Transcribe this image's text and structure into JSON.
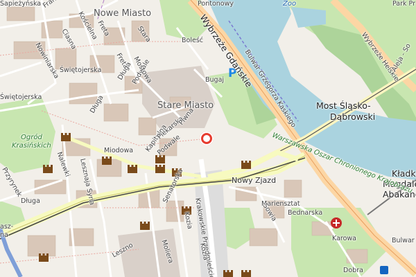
{
  "map": {
    "pin_name": "location-pin",
    "labels": {
      "nowe_miasto": "Nowe Miasto",
      "stare_miasto": "Stare Miasto",
      "most": "Most Śląsko-",
      "most2": "Dąbrowski",
      "kladka1": "Kładka",
      "kladka2": "Magdale",
      "kladka3": "Abakanow",
      "ogrod1": "Ogród",
      "ogrod2": "Krasińskich",
      "nowy_zjazd": "Nowy Zjazd",
      "marienszat": "Mariensztat",
      "wybrzeze_gdanskie": "Wybrzeże Gdańskie",
      "wybrzeze_helskie": "Wybrzeże Helskie",
      "aleja": "Aleja - So",
      "bulwar_kaskiego": "Bulwar Grzegorza Kaskiego",
      "warszawska_trasa": "Warszawska Oszar Chronionego Krajobrazu",
      "park_praski": "Park Pr",
      "zoo": "Zoo",
      "pontonowy": "Pontonowy",
      "bulwar_gier": "Bulwar gen",
      "karowa": "Karowa",
      "dobra": "Dobra",
      "miodowa": "Miodowa",
      "senatorska": "Senatorska",
      "moliera": "Moliera",
      "krakowskie": "Krakowskie Przedmieście",
      "kozia": "Kozia",
      "bednarska": "Bednarska",
      "sowia": "Sowia",
      "dluga": "Długa",
      "dluga2": "Długa",
      "dluga3": "Długa",
      "franciszkanska": "Franciszkańska",
      "sapiezynska": "Sapieżyńska",
      "nowiniarska": "Nowiniarska",
      "swietojerska": "Świętojerska",
      "swietojerska2": "Świętojerska",
      "kapitulna": "Kapitulna",
      "piekarska": "Piekarska",
      "podwale": "Podwale",
      "podwale2": "Podwale",
      "piwna": "Piwna",
      "mostowa": "Mostowa",
      "freta": "Freta",
      "freta2": "Freta",
      "koscielna": "Kościelna",
      "ciasna": "Ciasna",
      "stara": "Stara",
      "boleść": "Boleść",
      "bugaj": "Bugaj",
      "leszno": "Leszno",
      "szybka": "Lesznaja Syria",
      "nalewki": "Nalewki",
      "przyrynek": "Przyrynek",
      "kuchnia": "Kozia",
      "waszy": "asz-",
      "waszy2": "na"
    }
  }
}
